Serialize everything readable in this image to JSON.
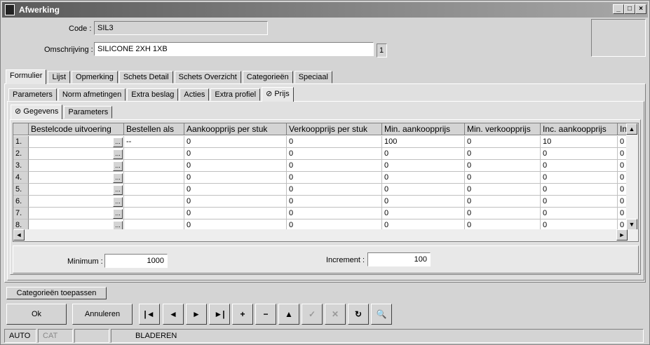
{
  "window": {
    "title": "Afwerking",
    "min": "_",
    "max": "□",
    "close": "×"
  },
  "form": {
    "code_label": "Code :",
    "code_value": "SIL3",
    "omschrijving_label": "Omschrijving :",
    "omschrijving_value": "SILICONE  2XH 1XB",
    "counter": "1"
  },
  "main_tabs": [
    "Formulier",
    "Lijst",
    "Opmerking",
    "Schets Detail",
    "Schets Overzicht",
    "Categorieën",
    "Speciaal"
  ],
  "sub_tabs": [
    "Parameters",
    "Norm afmetingen",
    "Extra beslag",
    "Acties",
    "Extra profiel",
    "Prijs"
  ],
  "inner_tabs": [
    "Gegevens",
    "Parameters"
  ],
  "grid": {
    "columns": [
      "Bestelcode uitvoering",
      "Bestellen als",
      "Aankoopprijs per stuk",
      "Verkoopprijs per stuk",
      "Min. aankoopprijs",
      "Min. verkoopprijs",
      "Inc. aankoopprijs",
      "In"
    ],
    "rows": [
      [
        "1.",
        "",
        "--",
        "0",
        "0",
        "100",
        "0",
        "10",
        "0"
      ],
      [
        "2.",
        "",
        "",
        "0",
        "0",
        "0",
        "0",
        "0",
        "0"
      ],
      [
        "3.",
        "",
        "",
        "0",
        "0",
        "0",
        "0",
        "0",
        "0"
      ],
      [
        "4.",
        "",
        "",
        "0",
        "0",
        "0",
        "0",
        "0",
        "0"
      ],
      [
        "5.",
        "",
        "",
        "0",
        "0",
        "0",
        "0",
        "0",
        "0"
      ],
      [
        "6.",
        "",
        "",
        "0",
        "0",
        "0",
        "0",
        "0",
        "0"
      ],
      [
        "7.",
        "",
        "",
        "0",
        "0",
        "0",
        "0",
        "0",
        "0"
      ],
      [
        "8.",
        "",
        "",
        "0",
        "0",
        "0",
        "0",
        "0",
        "0"
      ]
    ],
    "dots": "...",
    "scroll_up": "▲",
    "scroll_down": "▼",
    "scroll_left": "◄",
    "scroll_right": "►"
  },
  "minimum": {
    "label": "Minimum :",
    "value": "1000"
  },
  "increment": {
    "label": "Increment :",
    "value": "100"
  },
  "buttons": {
    "categorieen": "Categorieën toepassen",
    "ok": "Ok",
    "annuleren": "Annuleren"
  },
  "nav": {
    "first": "|◄",
    "prev": "◄",
    "next": "►",
    "last": "►|",
    "add": "+",
    "delete": "−",
    "up": "▲",
    "check": "✓",
    "cancel": "✕",
    "refresh": "↻",
    "find": "🔍"
  },
  "status": {
    "auto": "AUTO",
    "cat": "CAT",
    "mode": "BLADEREN"
  }
}
